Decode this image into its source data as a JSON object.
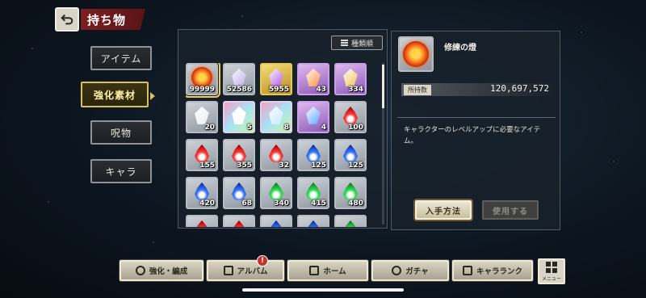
{
  "header": {
    "title": "持ち物",
    "back_icon": "back-arrow-icon"
  },
  "categories": [
    {
      "label": "アイテム",
      "active": false
    },
    {
      "label": "強化素材",
      "active": true
    },
    {
      "label": "呪物",
      "active": false
    },
    {
      "label": "キャラ",
      "active": false
    }
  ],
  "sort_button": {
    "label": "種類順",
    "icon": "sort-list-icon"
  },
  "items": [
    {
      "count": "99999",
      "kind": "orb",
      "frame": "gray",
      "selected": true
    },
    {
      "count": "52586",
      "kind": "crystal",
      "frame": "gray",
      "color": "#b9a8e8"
    },
    {
      "count": "5955",
      "kind": "crystal",
      "frame": "gold",
      "color": "#b04fe0"
    },
    {
      "count": "43",
      "kind": "crystal",
      "frame": "purple",
      "color": "#ff8a3a"
    },
    {
      "count": "334",
      "kind": "crystal",
      "frame": "purple",
      "color": "#f0c050"
    },
    {
      "count": "20",
      "kind": "crystal",
      "frame": "gray",
      "color": "#e8eef5"
    },
    {
      "count": "5",
      "kind": "crystal",
      "frame": "rainbow",
      "color": "#ffffff"
    },
    {
      "count": "8",
      "kind": "crystal",
      "frame": "rainbow",
      "color": "#bfe8ff"
    },
    {
      "count": "4",
      "kind": "crystal",
      "frame": "purple",
      "color": "#5aa0ff"
    },
    {
      "count": "100",
      "kind": "flame",
      "frame": "gray",
      "color": "red"
    },
    {
      "count": "155",
      "kind": "flame",
      "frame": "gray",
      "color": "red"
    },
    {
      "count": "355",
      "kind": "flame",
      "frame": "gray",
      "color": "red"
    },
    {
      "count": "32",
      "kind": "flame",
      "frame": "gray",
      "color": "red"
    },
    {
      "count": "125",
      "kind": "flame",
      "frame": "gray",
      "color": "blue"
    },
    {
      "count": "125",
      "kind": "flame",
      "frame": "gray",
      "color": "blue"
    },
    {
      "count": "420",
      "kind": "flame",
      "frame": "gray",
      "color": "blue"
    },
    {
      "count": "68",
      "kind": "flame",
      "frame": "gray",
      "color": "blue"
    },
    {
      "count": "340",
      "kind": "flame",
      "frame": "gray",
      "color": "green"
    },
    {
      "count": "415",
      "kind": "flame",
      "frame": "gray",
      "color": "green"
    },
    {
      "count": "480",
      "kind": "flame",
      "frame": "gray",
      "color": "green"
    },
    {
      "count": "",
      "kind": "flame",
      "frame": "gray",
      "color": "red"
    },
    {
      "count": "",
      "kind": "flame",
      "frame": "gray",
      "color": "red"
    },
    {
      "count": "",
      "kind": "flame",
      "frame": "gray",
      "color": "blue"
    },
    {
      "count": "",
      "kind": "flame",
      "frame": "gray",
      "color": "blue"
    },
    {
      "count": "",
      "kind": "flame",
      "frame": "gray",
      "color": "green"
    }
  ],
  "detail": {
    "name": "修練の燈",
    "owned_label": "所持数",
    "owned_value": "120,697,572",
    "description": "キャラクターのレベルアップに必要なアイテム。",
    "obtain_label": "入手方法",
    "use_label": "使用する"
  },
  "bottom_nav": [
    {
      "label": "強化・編成",
      "icon": "upgrade-icon"
    },
    {
      "label": "アルバム",
      "icon": "album-icon",
      "badge": "!"
    },
    {
      "label": "ホーム",
      "icon": "home-icon"
    },
    {
      "label": "ガチャ",
      "icon": "gacha-icon"
    },
    {
      "label": "キャラランク",
      "icon": "rank-icon"
    }
  ],
  "menu": {
    "label": "メニュー"
  },
  "colors": {
    "accent": "#7b1f22",
    "active_tab": "#d6c25a",
    "selected_outline": "#f2cf48"
  }
}
